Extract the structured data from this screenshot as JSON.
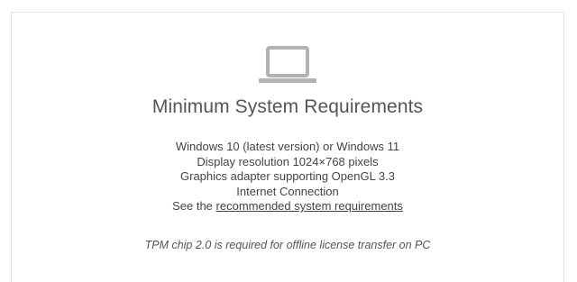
{
  "card": {
    "icon": "laptop-icon",
    "title": "Minimum System Requirements",
    "requirements": [
      "Windows 10 (latest version) or Windows 11",
      "Display resolution 1024×768 pixels",
      "Graphics adapter supporting OpenGL 3.3",
      "Internet Connection"
    ],
    "see_prefix": "See the ",
    "link_label": "recommended system requirements",
    "note": "TPM chip 2.0 is required for offline license transfer on PC"
  },
  "colors": {
    "icon": "#b3b3b3",
    "title": "#555555",
    "text": "#444444",
    "border": "#e2e2e2"
  }
}
